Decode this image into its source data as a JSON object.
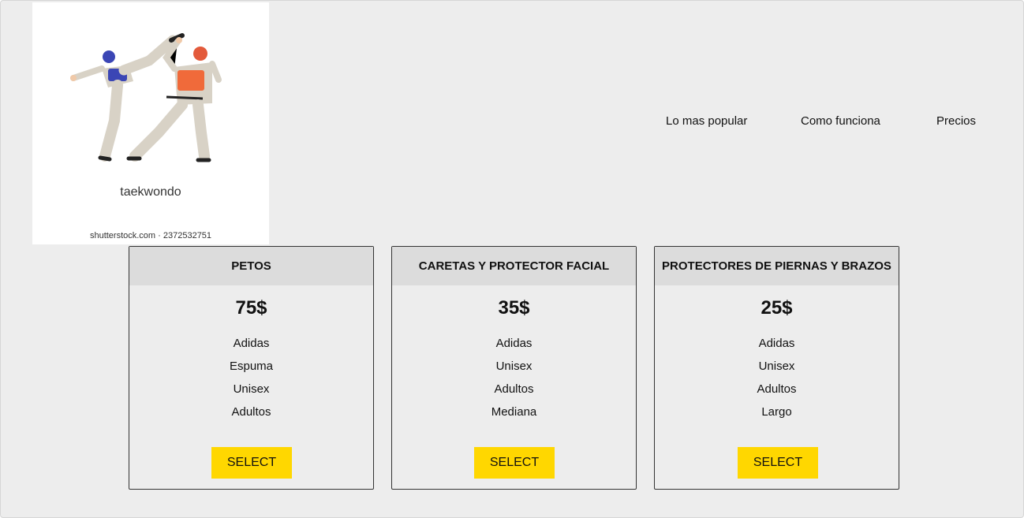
{
  "logo": {
    "caption": "taekwondo",
    "credit": "shutterstock.com · 2372532751"
  },
  "nav": {
    "items": [
      "Lo mas popular",
      "Como funciona",
      "Precios"
    ]
  },
  "plans": [
    {
      "title": "PETOS",
      "price": "75$",
      "features": [
        "Adidas",
        "Espuma",
        "Unisex",
        "Adultos"
      ],
      "button": "SELECT"
    },
    {
      "title": "CARETAS Y PROTECTOR FACIAL",
      "price": "35$",
      "features": [
        "Adidas",
        "Unisex",
        "Adultos",
        "Mediana"
      ],
      "button": "SELECT"
    },
    {
      "title": "PROTECTORES DE PIERNAS Y BRAZOS",
      "price": "25$",
      "features": [
        "Adidas",
        "Unisex",
        "Adultos",
        "Largo"
      ],
      "button": "SELECT"
    }
  ],
  "colors": {
    "background": "#ededed",
    "card_header": "#dcdcdc",
    "button": "#ffd700"
  }
}
